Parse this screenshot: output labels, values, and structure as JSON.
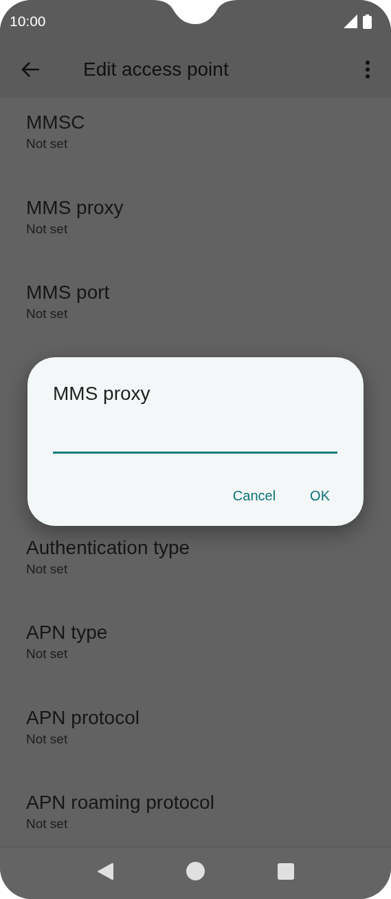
{
  "status_bar": {
    "time": "10:00"
  },
  "app_bar": {
    "title": "Edit access point"
  },
  "settings_above_dialog": [
    {
      "title": "MMSC",
      "value": "Not set"
    },
    {
      "title": "MMS proxy",
      "value": "Not set"
    },
    {
      "title": "MMS port",
      "value": "Not set"
    }
  ],
  "settings_below_dialog": [
    {
      "title": "Authentication type",
      "value": "Not set"
    },
    {
      "title": "APN type",
      "value": "Not set"
    },
    {
      "title": "APN protocol",
      "value": "Not set"
    },
    {
      "title": "APN roaming protocol",
      "value": "Not set"
    }
  ],
  "dialog": {
    "title": "MMS proxy",
    "buttons": [
      "Cancel",
      "OK"
    ]
  }
}
